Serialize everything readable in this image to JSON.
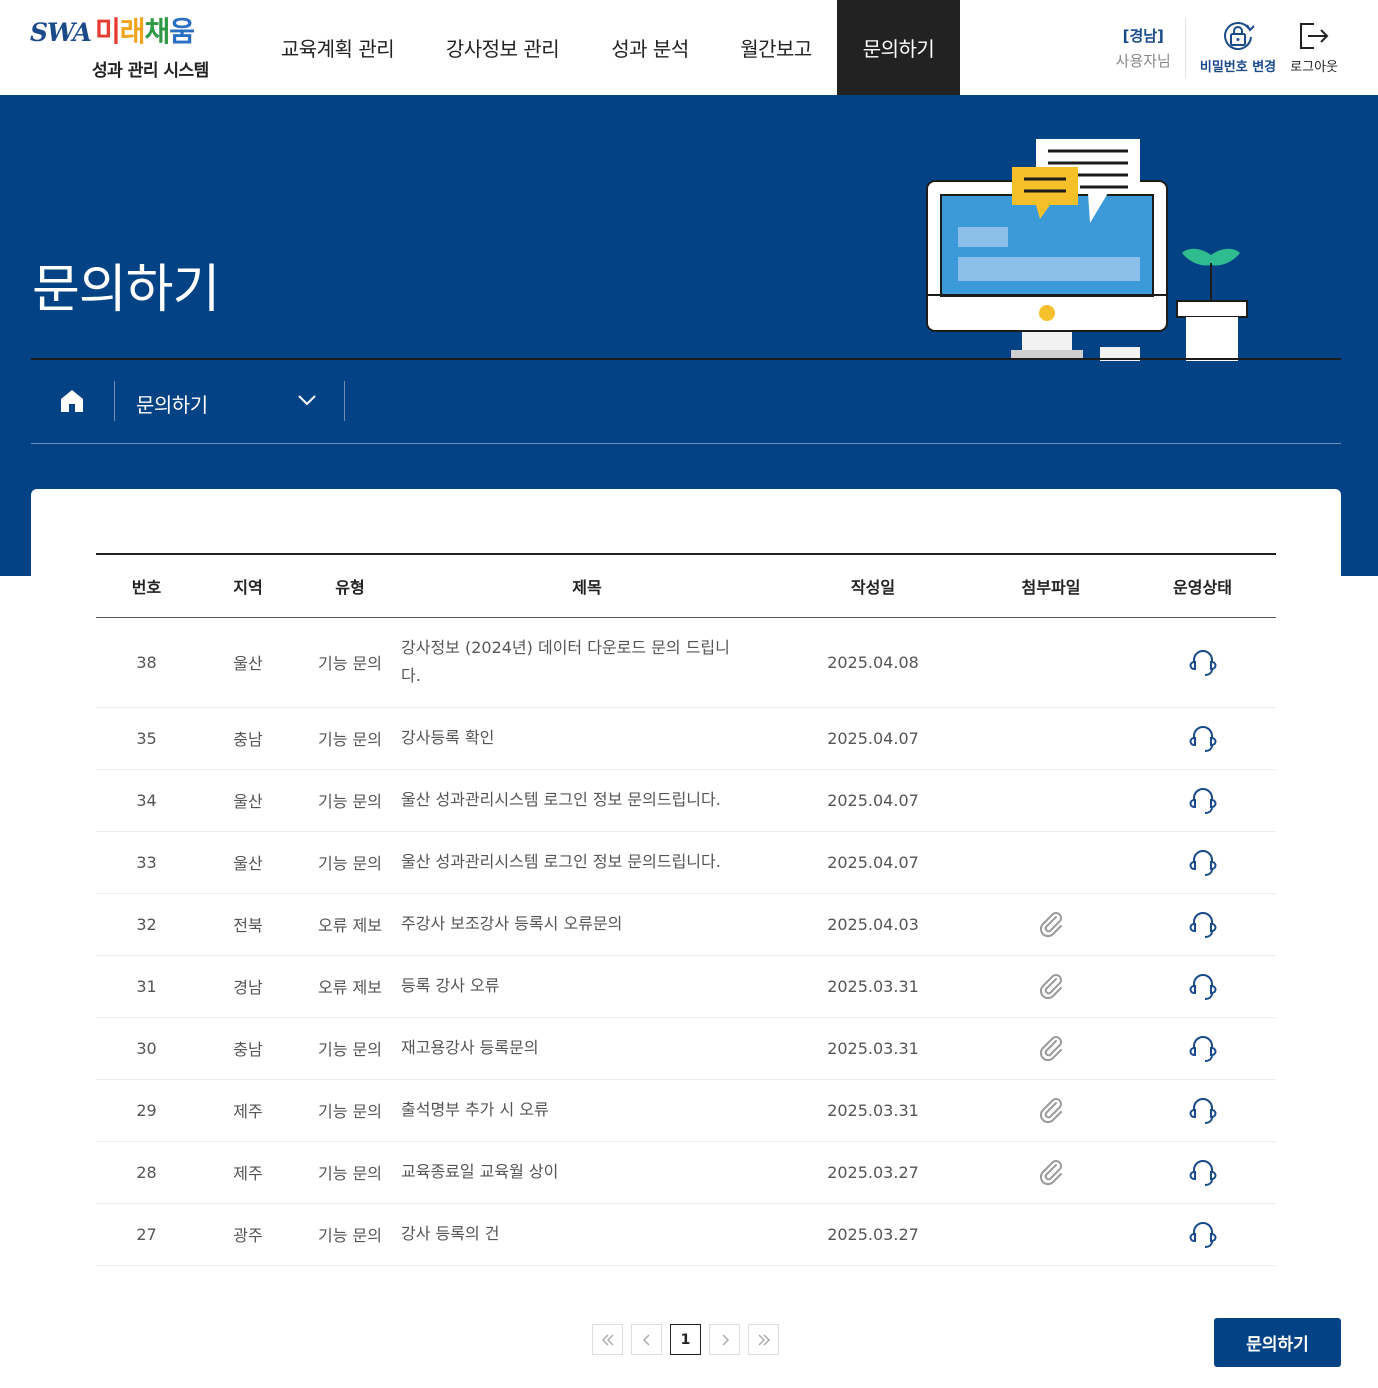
{
  "header": {
    "logo_swa": "SWA",
    "logo_mirae": [
      "미",
      "래",
      "채",
      "움"
    ],
    "logo_sub": "성과 관리 시스템",
    "nav": [
      {
        "label": "교육계획 관리",
        "active": false
      },
      {
        "label": "강사정보 관리",
        "active": false
      },
      {
        "label": "성과 분석",
        "active": false
      },
      {
        "label": "월간보고",
        "active": false
      },
      {
        "label": "문의하기",
        "active": true
      }
    ],
    "user_region": "[경남]",
    "user_name": "사용자님",
    "change_password": "비밀번호 변경",
    "logout": "로그아웃"
  },
  "hero": {
    "title": "문의하기",
    "breadcrumb": "문의하기"
  },
  "table": {
    "columns": [
      "번호",
      "지역",
      "유형",
      "제목",
      "작성일",
      "첨부파일",
      "운영상태"
    ],
    "rows": [
      {
        "no": "38",
        "region": "울산",
        "type": "기능 문의",
        "title": "강사정보 (2024년) 데이터 다운로드 문의 드립니다.",
        "date": "2025.04.08",
        "attachment": false,
        "status_icon": "headset-icon"
      },
      {
        "no": "35",
        "region": "충남",
        "type": "기능 문의",
        "title": "강사등록 확인",
        "date": "2025.04.07",
        "attachment": false,
        "status_icon": "headset-icon"
      },
      {
        "no": "34",
        "region": "울산",
        "type": "기능 문의",
        "title": "울산 성과관리시스템 로그인 정보 문의드립니다.",
        "date": "2025.04.07",
        "attachment": false,
        "status_icon": "headset-icon"
      },
      {
        "no": "33",
        "region": "울산",
        "type": "기능 문의",
        "title": "울산 성과관리시스템 로그인 정보 문의드립니다.",
        "date": "2025.04.07",
        "attachment": false,
        "status_icon": "headset-icon"
      },
      {
        "no": "32",
        "region": "전북",
        "type": "오류 제보",
        "title": "주강사 보조강사 등록시 오류문의",
        "date": "2025.04.03",
        "attachment": true,
        "status_icon": "headset-icon"
      },
      {
        "no": "31",
        "region": "경남",
        "type": "오류 제보",
        "title": "등록 강사 오류",
        "date": "2025.03.31",
        "attachment": true,
        "status_icon": "headset-icon"
      },
      {
        "no": "30",
        "region": "충남",
        "type": "기능 문의",
        "title": "재고용강사 등록문의",
        "date": "2025.03.31",
        "attachment": true,
        "status_icon": "headset-icon"
      },
      {
        "no": "29",
        "region": "제주",
        "type": "기능 문의",
        "title": "출석명부 추가 시 오류",
        "date": "2025.03.31",
        "attachment": true,
        "status_icon": "headset-icon"
      },
      {
        "no": "28",
        "region": "제주",
        "type": "기능 문의",
        "title": "교육종료일 교육월 상이",
        "date": "2025.03.27",
        "attachment": true,
        "status_icon": "headset-icon"
      },
      {
        "no": "27",
        "region": "광주",
        "type": "기능 문의",
        "title": "강사 등록의 건",
        "date": "2025.03.27",
        "attachment": false,
        "status_icon": "headset-icon"
      }
    ]
  },
  "pagination": {
    "current": "1"
  },
  "write_button": "문의하기",
  "colors": {
    "primary": "#034385",
    "nav_active_bg": "#222222",
    "text": "#222222"
  }
}
